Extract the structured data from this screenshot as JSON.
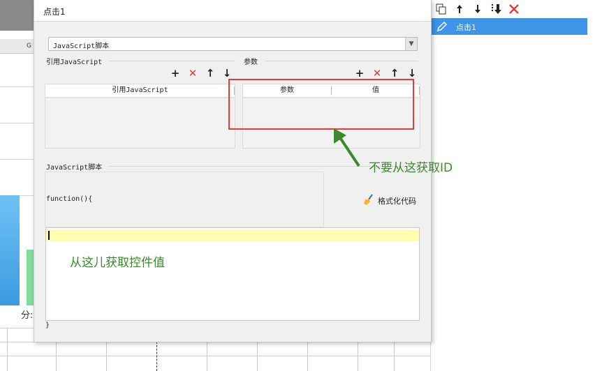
{
  "dialog": {
    "title": "点击1",
    "script_type": "JavaScript脚本",
    "ref_js_label": "引用JavaScript",
    "params_label": "参数",
    "ref_table": {
      "columns": [
        "引用JavaScript"
      ]
    },
    "params_table": {
      "columns": [
        "参数",
        "值"
      ]
    },
    "script_label": "JavaScript脚本",
    "code_head": "function(){",
    "code_tail": "}",
    "format_button": "格式化代码"
  },
  "right_panel": {
    "toolbar": [
      "copy-icon",
      "arrow-up-icon",
      "arrow-down-icon",
      "move-bottom-icon",
      "delete-icon"
    ],
    "selected_item": "点击1"
  },
  "background": {
    "column_letter": "G",
    "axis_text": "分:"
  },
  "annotations": {
    "no_id_here": "不要从这获取ID",
    "get_value_here": "从这儿获取控件值",
    "accent_green": "#3b8a2a",
    "accent_red": "#e23b3b"
  }
}
